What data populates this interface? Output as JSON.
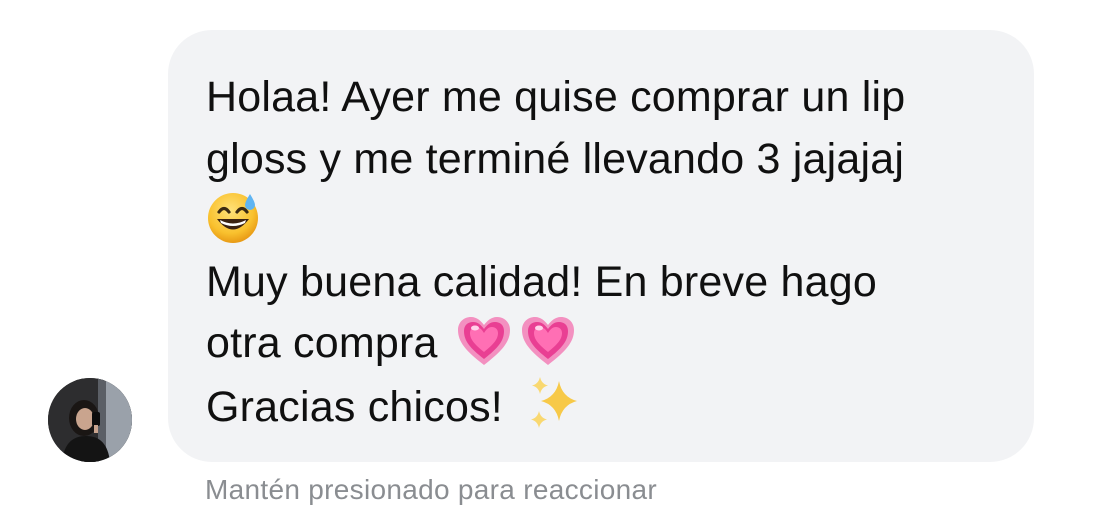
{
  "message": {
    "line1": "Holaa! Ayer me quise comprar un lip",
    "line2": "gloss y me terminé llevando 3 jajajaj",
    "line4": "Muy buena calidad! En breve hago",
    "line5": "otra compra",
    "line6": "Gracias chicos!",
    "emojis": [
      "grinning-face-with-sweat-icon",
      "growing-heart-icon",
      "growing-heart-icon",
      "sparkles-icon"
    ]
  },
  "reaction_hint": "Mantén presionado para reaccionar",
  "colors": {
    "bubble": "#f2f3f5",
    "text": "#101010",
    "hint": "#8a8d91",
    "heart": "#f0509c",
    "sparkle": "#f7c948"
  }
}
